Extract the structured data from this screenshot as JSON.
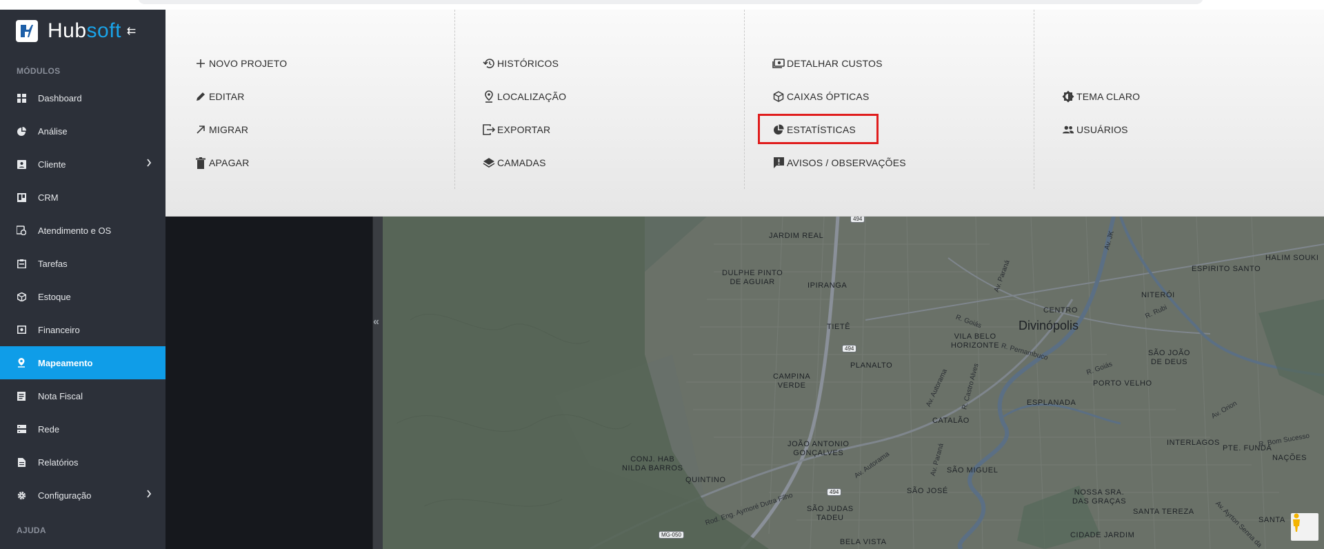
{
  "brand": {
    "name_part1": "Hub",
    "name_part2": "soft",
    "collapse_glyph": "⇇",
    "accent": "#1aa3e8"
  },
  "sidebar": {
    "section_modules": "MÓDULOS",
    "section_help": "AJUDA",
    "active_color": "#0f9de8",
    "items": [
      {
        "label": "Dashboard",
        "icon": "dashboard-icon"
      },
      {
        "label": "Análise",
        "icon": "pie-chart-icon"
      },
      {
        "label": "Cliente",
        "icon": "contact-card-icon",
        "has_submenu": true
      },
      {
        "label": "CRM",
        "icon": "trello-board-icon"
      },
      {
        "label": "Atendimento e OS",
        "icon": "clock-calendar-icon"
      },
      {
        "label": "Tarefas",
        "icon": "task-board-icon"
      },
      {
        "label": "Estoque",
        "icon": "box-icon"
      },
      {
        "label": "Financeiro",
        "icon": "money-icon"
      },
      {
        "label": "Mapeamento",
        "icon": "map-pin-icon",
        "active": true
      },
      {
        "label": "Nota Fiscal",
        "icon": "invoice-icon"
      },
      {
        "label": "Rede",
        "icon": "server-icon"
      },
      {
        "label": "Relatórios",
        "icon": "report-icon"
      },
      {
        "label": "Configuração",
        "icon": "gear-icon",
        "has_submenu": true
      }
    ]
  },
  "menu": {
    "col1": [
      {
        "label": "NOVO PROJETO",
        "icon": "plus-icon"
      },
      {
        "label": "EDITAR",
        "icon": "pencil-icon"
      },
      {
        "label": "MIGRAR",
        "icon": "arrow-up-right-icon"
      },
      {
        "label": "APAGAR",
        "icon": "trash-icon"
      }
    ],
    "col2": [
      {
        "label": "HISTÓRICOS",
        "icon": "history-icon"
      },
      {
        "label": "LOCALIZAÇÃO",
        "icon": "location-pin-icon"
      },
      {
        "label": "EXPORTAR",
        "icon": "export-icon"
      },
      {
        "label": "CAMADAS",
        "icon": "layers-icon"
      }
    ],
    "col3": [
      {
        "label": "DETALHAR CUSTOS",
        "icon": "costs-icon"
      },
      {
        "label": "CAIXAS ÓPTICAS",
        "icon": "cube-icon"
      },
      {
        "label": "ESTATÍSTICAS",
        "icon": "pie-chart-icon",
        "highlighted": true
      },
      {
        "label": "AVISOS / OBSERVAÇÕES",
        "icon": "alert-message-icon"
      }
    ],
    "col4": [
      {
        "label": "TEMA CLARO",
        "icon": "brightness-icon"
      },
      {
        "label": "USUÁRIOS",
        "icon": "users-icon"
      }
    ],
    "highlight_color": "#e01d1d"
  },
  "map": {
    "splitter_glyph": "«",
    "labels": {
      "jardim_real": "JARDIM REAL",
      "halim_souki": "HALIM SOUKI",
      "espirito_santo": "ESPIRITO SANTO",
      "dulphe_1": "DULPHE PINTO",
      "dulphe_2": "DE AGUIAR",
      "ipiranga": "IPIRANGA",
      "av_parana": "Av. Paraná",
      "av_jk": "Av. JK",
      "centro": "CENTRO",
      "divinopolis": "Divinópolis",
      "niteroi": "NITERÓI",
      "r_rubi": "R. Rubi",
      "tiete": "TIETÊ",
      "r_goias": "R. Goiás",
      "vila_belo_1": "VILA BELO",
      "vila_belo_2": "HORIZONTE",
      "r_pernambuco": "R. Pernambuco",
      "r_goias2": "R. Goiás",
      "sao_joao_1": "SÃO JOÃO",
      "sao_joao_2": "DE DEUS",
      "planalto": "PLANALTO",
      "campina_1": "CAMPINA",
      "campina_2": "VERDE",
      "porto_velho": "PORTO VELHO",
      "av_autorama": "Av. Autorama",
      "r_castro": "R. Castro Alves",
      "esplanada": "ESPLANADA",
      "catalao": "CATALÃO",
      "av_orion": "Av. Orion",
      "joao_antonio_1": "JOÃO ANTONIO",
      "joao_antonio_2": "GONÇALVES",
      "av_parana2": "Av. Paraná",
      "interlagos": "INTERLAGOS",
      "pte_funda": "PTE. FUNDA",
      "r_bom": "R. Bom Sucesso",
      "conj_1": "CONJ. HAB",
      "conj_2": "NILDA BARROS",
      "av_autorama2": "Av. Autorama",
      "sao_miguel": "SÃO MIGUEL",
      "nacoes": "NAÇÕES",
      "quintino": "QUINTINO",
      "sao_jose": "SÃO JOSÉ",
      "nossa_1": "NOSSA SRA.",
      "nossa_2": "DAS GRAÇAS",
      "rod_eng": "Rod. Eng. Aymoré Dutra Filho",
      "sao_judas_1": "SÃO JUDAS",
      "sao_judas_2": "TADEU",
      "santa_tereza": "SANTA TEREZA",
      "santa": "SANTA",
      "bela_vista": "BELA VISTA",
      "cidade_jardim": "CIDADE JARDIM",
      "av_ayrton": "Av. Ayrton Senna da",
      "shield_494_a": "494",
      "shield_494_b": "494",
      "shield_494_c": "494",
      "shield_mg": "MG-050"
    }
  }
}
